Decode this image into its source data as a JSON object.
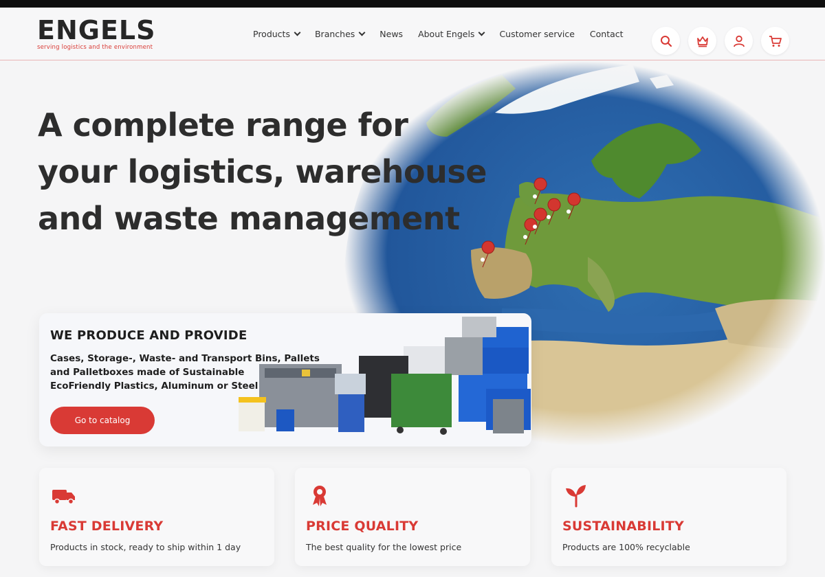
{
  "brand": {
    "name": "ENGELS",
    "tagline": "serving logistics and the environment",
    "accent": "#d93a35"
  },
  "nav": {
    "items": [
      {
        "label": "Products",
        "dropdown": true
      },
      {
        "label": "Branches",
        "dropdown": true
      },
      {
        "label": "News",
        "dropdown": false
      },
      {
        "label": "About Engels",
        "dropdown": true
      },
      {
        "label": "Customer service",
        "dropdown": false
      },
      {
        "label": "Contact",
        "dropdown": false
      }
    ]
  },
  "header_icons": [
    "search-icon",
    "language-flag-icon",
    "account-icon",
    "cart-icon"
  ],
  "hero": {
    "title_line1": "A complete range for",
    "title_line2": "your logistics, warehouse",
    "title_line3": "and waste management"
  },
  "promo": {
    "title": "WE PRODUCE AND PROVIDE",
    "text_line1": "Cases, Storage-, Waste- and Transport Bins, Pallets",
    "text_line2": "and Palletboxes made of Sustainable",
    "text_line3": "EcoFriendly Plastics, Aluminum or Steel",
    "button_label": "Go to catalog"
  },
  "features": [
    {
      "icon": "truck-icon",
      "title": "FAST DELIVERY",
      "text": "Products in stock, ready to ship within 1 day"
    },
    {
      "icon": "award-icon",
      "title": "PRICE QUALITY",
      "text": "The best quality for the lowest price"
    },
    {
      "icon": "sprout-icon",
      "title": "SUSTAINABILITY",
      "text": "Products are 100% recyclable"
    }
  ]
}
